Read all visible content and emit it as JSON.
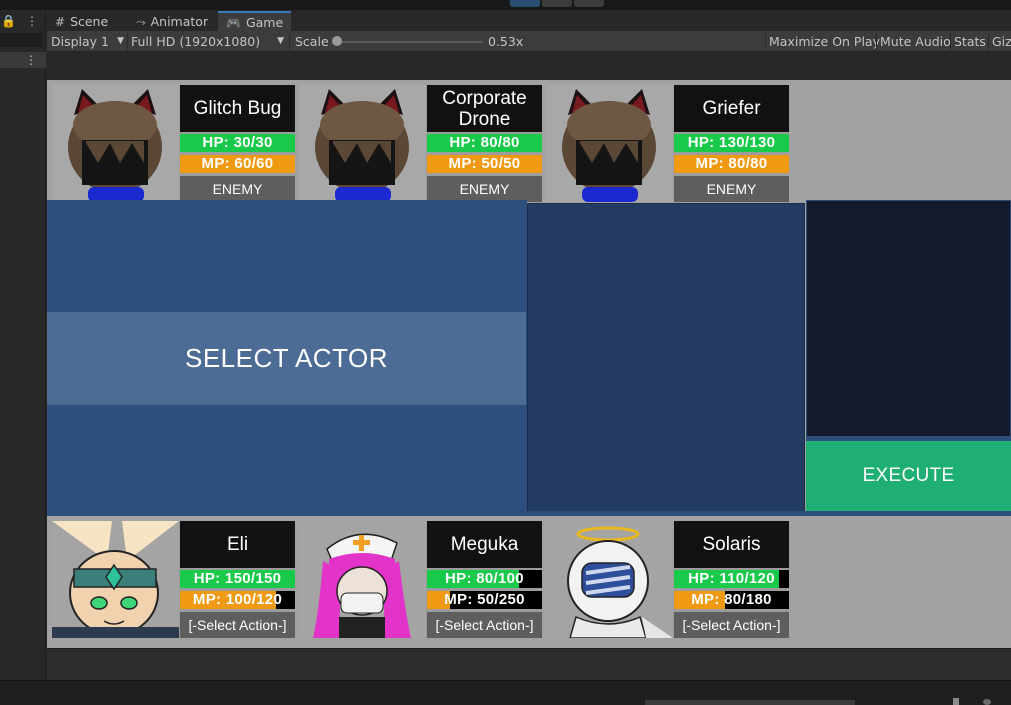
{
  "toolbar_top": {
    "icons": [
      "play-icon",
      "pause-icon",
      "step-icon"
    ]
  },
  "left_panel": {
    "lock_icon": "🔒",
    "menu_icon": "⋮",
    "row_menu_icon": "⋮"
  },
  "tabs": [
    {
      "label": "Scene",
      "icon": "#"
    },
    {
      "label": "Animator",
      "icon": "⤳"
    },
    {
      "label": "Game",
      "icon": "🎮"
    }
  ],
  "tab_menu_icon": "⋮",
  "game_toolbar": {
    "display": "Display 1",
    "resolution": "Full HD (1920x1080)",
    "scale_label": "Scale",
    "scale_value": "0.53x",
    "scale_fraction": 0.0,
    "maximize": "Maximize On Play",
    "mute": "Mute Audio",
    "stats": "Stats",
    "gizmos": "Giz"
  },
  "enemies": [
    {
      "name": "Glitch Bug",
      "hp": "HP: 30/30",
      "hp_fraction": 1.0,
      "mp": "MP: 60/60",
      "mp_fraction": 1.0,
      "tag": "ENEMY"
    },
    {
      "name": "Corporate Drone",
      "hp": "HP: 80/80",
      "hp_fraction": 1.0,
      "mp": "MP: 50/50",
      "mp_fraction": 1.0,
      "tag": "ENEMY"
    },
    {
      "name": "Griefer",
      "hp": "HP: 130/130",
      "hp_fraction": 1.0,
      "mp": "MP: 80/80",
      "mp_fraction": 1.0,
      "tag": "ENEMY"
    }
  ],
  "party": [
    {
      "name": "Eli",
      "hp": "HP: 150/150",
      "hp_fraction": 1.0,
      "mp": "MP: 100/120",
      "mp_fraction": 0.833,
      "tag": "[-Select Action-]"
    },
    {
      "name": "Meguka",
      "hp": "HP: 80/100",
      "hp_fraction": 0.8,
      "mp": "MP: 50/250",
      "mp_fraction": 0.2,
      "tag": "[-Select Action-]"
    },
    {
      "name": "Solaris",
      "hp": "HP: 110/120",
      "hp_fraction": 0.917,
      "mp": "MP: 80/180",
      "mp_fraction": 0.444,
      "tag": "[-Select Action-]"
    }
  ],
  "select_actor": "SELECT ACTOR",
  "execute": "EXECUTE",
  "colors": {
    "hp": "#18c94a",
    "mp": "#ef9a12",
    "panel": "#2d4f7e",
    "execute": "#1fae74"
  }
}
